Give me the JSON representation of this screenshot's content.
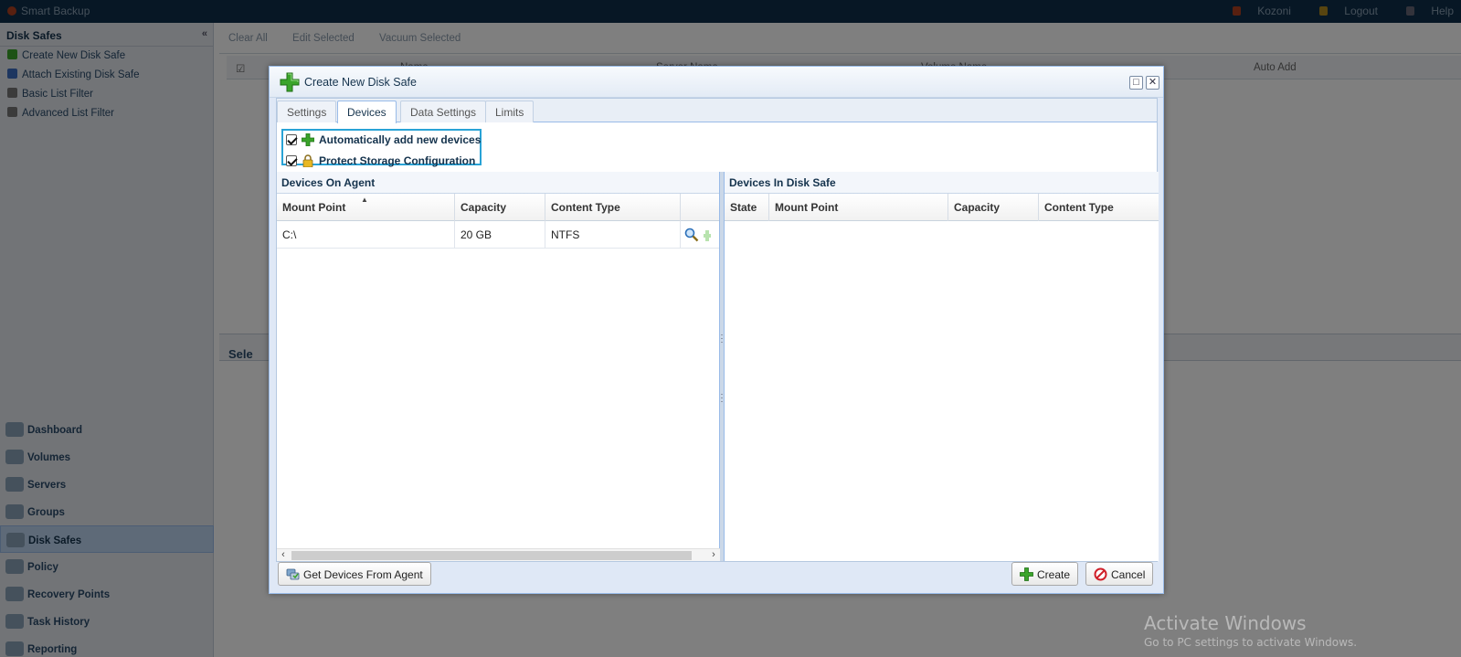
{
  "app": {
    "name": "Smart Backup",
    "user": "Kozoni",
    "logout": "Logout",
    "help": "Help"
  },
  "sidebar": {
    "title": "Disk Safes",
    "links": [
      {
        "label": "Create New Disk Safe",
        "icon": "plus-icon"
      },
      {
        "label": "Attach Existing Disk Safe",
        "icon": "attach-icon"
      },
      {
        "label": "Basic List Filter",
        "icon": "filter-icon"
      },
      {
        "label": "Advanced List Filter",
        "icon": "advanced-filter-icon"
      }
    ],
    "nav": [
      {
        "label": "Dashboard"
      },
      {
        "label": "Volumes"
      },
      {
        "label": "Servers"
      },
      {
        "label": "Groups"
      },
      {
        "label": "Disk Safes"
      },
      {
        "label": "Policy"
      },
      {
        "label": "Recovery Points"
      },
      {
        "label": "Task History"
      },
      {
        "label": "Reporting"
      }
    ]
  },
  "main": {
    "toolbar": [
      "Clear All",
      "Edit Selected",
      "Vacuum Selected"
    ],
    "columns": [
      "Name",
      "Server Name",
      "Volume Name",
      "Auto Add"
    ],
    "selection_hint": "Sele"
  },
  "dialog": {
    "title": "Create New Disk Safe",
    "maximize_symbol": "□",
    "close_symbol": "✕",
    "tabs": [
      {
        "label": "Settings",
        "active": false
      },
      {
        "label": "Devices",
        "active": true
      },
      {
        "label": "Data Settings",
        "active": false
      },
      {
        "label": "Limits",
        "active": false
      }
    ],
    "options": {
      "auto_add": {
        "label": "Automatically add new devices",
        "checked": true
      },
      "protect": {
        "label": "Protect Storage Configuration",
        "checked": true
      }
    },
    "devices_on_agent": {
      "title": "Devices On Agent",
      "columns": [
        "Mount Point",
        "Capacity",
        "Content Type"
      ],
      "sort_indicator": "▲",
      "rows": [
        {
          "mount_point": "C:\\",
          "capacity": "20 GB",
          "content_type": "NTFS"
        }
      ]
    },
    "devices_in_disk_safe": {
      "title": "Devices In Disk Safe",
      "columns": [
        "State",
        "Mount Point",
        "Capacity",
        "Content Type"
      ],
      "rows": []
    },
    "buttons": {
      "get_devices": "Get Devices From Agent",
      "create": "Create",
      "cancel": "Cancel"
    }
  },
  "watermark": {
    "title": "Activate Windows",
    "subtitle": "Go to PC settings to activate Windows."
  },
  "colors": {
    "accent": "#29a3d6",
    "dialog_border": "#99bbe8",
    "plus_green": "#3aa42a",
    "cancel_red": "#d0202a"
  }
}
